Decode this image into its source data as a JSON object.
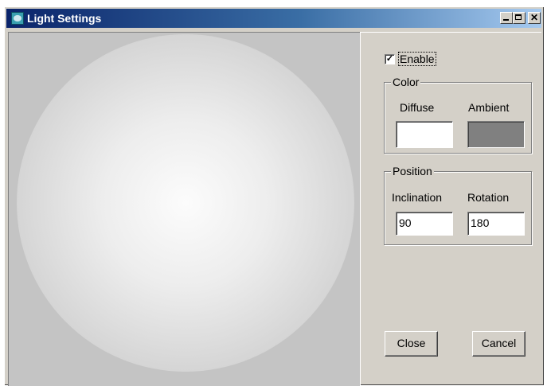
{
  "window": {
    "title": "Light Settings",
    "app_icon": "light-settings-icon",
    "controls": {
      "minimize": "minimize-icon",
      "maximize": "maximize-icon",
      "close": "✕"
    }
  },
  "preview": {
    "shape": "sphere"
  },
  "enable": {
    "label": "Enable",
    "checked": true,
    "mark": "✓"
  },
  "color": {
    "title": "Color",
    "diffuse_label": "Diffuse",
    "ambient_label": "Ambient",
    "diffuse_color": "#ffffff",
    "ambient_color": "#808080"
  },
  "position": {
    "title": "Position",
    "inclination_label": "Inclination",
    "rotation_label": "Rotation",
    "inclination_value": "90",
    "rotation_value": "180"
  },
  "buttons": {
    "close": "Close",
    "cancel": "Cancel"
  }
}
